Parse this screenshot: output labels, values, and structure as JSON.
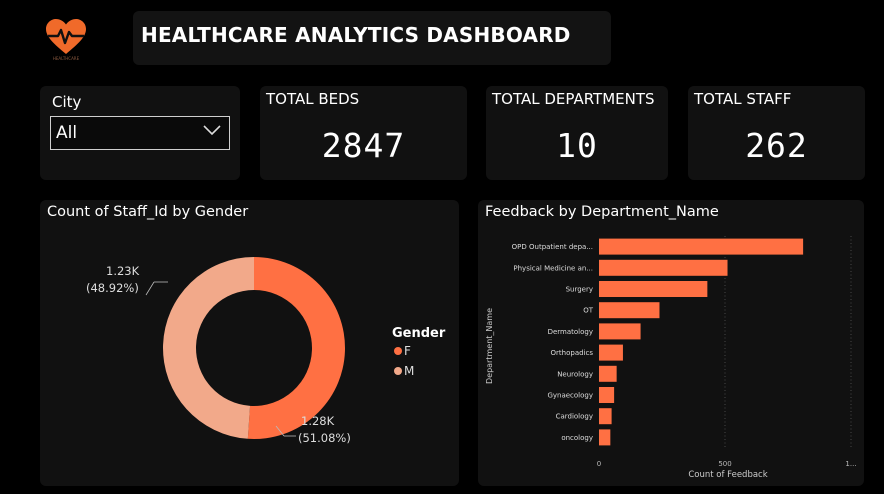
{
  "header": {
    "title": "HEALTHCARE ANALYTICS DASHBOARD",
    "logo_caption": "HEALTHCARE"
  },
  "filter": {
    "label": "City",
    "value": "All"
  },
  "kpis": {
    "beds": {
      "label": "TOTAL BEDS",
      "value": "2847"
    },
    "departments": {
      "label": "TOTAL DEPARTMENTS",
      "value": "10"
    },
    "staff": {
      "label": "TOTAL STAFF",
      "value": "262"
    }
  },
  "colors": {
    "female": "#ff7043",
    "male": "#f2a98a",
    "bar": "#ff7043",
    "card": "#111111"
  },
  "donut": {
    "title": "Count of Staff_Id by Gender",
    "legend_title": "Gender",
    "slices": [
      {
        "name": "F",
        "percent": 51.08,
        "value_label": "1.28K",
        "pct_label": "(51.08%)"
      },
      {
        "name": "M",
        "percent": 48.92,
        "value_label": "1.23K",
        "pct_label": "(48.92%)"
      }
    ]
  },
  "chart_data": {
    "type": "bar",
    "orientation": "horizontal",
    "title": "Feedback by Department_Name",
    "xlabel": "Count of Feedback",
    "ylabel": "Department_Name",
    "categories": [
      "OPD Outpatient depa...",
      "Physical Medicine an...",
      "Surgery",
      "OT",
      "Dermatology",
      "Orthopadics",
      "Neurology",
      "Gynaecology",
      "Cardiology",
      "oncology"
    ],
    "values": [
      810,
      510,
      430,
      240,
      165,
      95,
      70,
      60,
      50,
      45
    ],
    "xlim": [
      0,
      1000
    ],
    "x_ticks": [
      "0",
      "500",
      "1..."
    ],
    "x_tick_values": [
      0,
      500,
      1000
    ],
    "grid": true
  }
}
